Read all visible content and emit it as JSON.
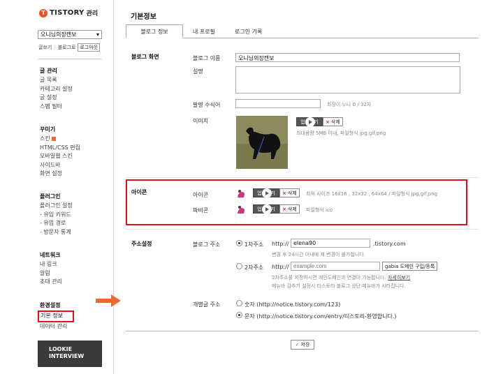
{
  "sidebar": {
    "logo_mark": "T",
    "logo_text": "TISTORY",
    "logo_sub": "관리",
    "blog_select": "오니님의장캔보",
    "quick_links": [
      "글쓰기",
      "블로그로"
    ],
    "logout": "로그아웃",
    "groups": [
      {
        "title": "글 관리",
        "items": [
          "글 목록",
          "카테고리 설정",
          "글 설정",
          "스팸 필터"
        ]
      },
      {
        "title": "꾸미기",
        "items": [
          "스킨",
          "HTML/CSS 편집",
          "모바일웹 스킨",
          "사이드바",
          "화면 설정"
        ]
      },
      {
        "title": "플러그인",
        "items": [
          "플러그인 설정",
          "- 유입 키워드",
          "- 유입 경로",
          "- 방문자 통계"
        ]
      },
      {
        "title": "네트워크",
        "items": [
          "내 링크",
          "알림",
          "초대 관리"
        ]
      },
      {
        "title": "환경설정",
        "items": [
          "기본 정보",
          "데이터 관리"
        ]
      }
    ],
    "banner_line1": "LOOKIE",
    "banner_line2": "INTERVIEW"
  },
  "main": {
    "title": "기본정보",
    "tabs": [
      "블로그 정보",
      "내 프로필",
      "로그인 기록"
    ],
    "blog_section": {
      "label": "블로그 화면",
      "name_label": "블로그 이름",
      "name_value": "오니님의장캔보",
      "desc_label": "설명",
      "modifier_label": "팔명 수식어",
      "modifier_hint_prefix": "최장이 누나",
      "modifier_count": "0",
      "modifier_max": "/ 32자",
      "image_label": "이미지",
      "image_hint": "최대용량 5MB 이내, 파일형식 jpg,gif,png"
    },
    "icon_section": {
      "label": "아이콘",
      "icon_label": "아이콘",
      "icon_hint": "최적 사이즈 16x16 , 32x32 , 64x64 / 파일형식 jpg,gif,png",
      "favicon_label": "파비콘",
      "favicon_hint": "파일형식 ico"
    },
    "buttons": {
      "change": "업로드기",
      "delete": "삭제",
      "save": "저장",
      "gabia": "gabia 도메인 구입/등록"
    },
    "address_section": {
      "label": "주소설정",
      "blog_address_label": "블로그 주소",
      "primary_label": "1차주소",
      "http_prefix": "http://",
      "primary_value": "elena90",
      "primary_suffix": ".tistory.com",
      "primary_hint": "변경 후 24시간 이내에 재 변경이 불가합니다.",
      "secondary_label": "2차주소",
      "secondary_placeholder": "example.com",
      "secondary_hint1": "2차주소를 지정하시면 개인도메인과 연결이 가능합니다.",
      "secondary_hint_link": "자세히보기",
      "secondary_hint2": "메뉴바 감추기 설정시 티스토리 블로그 상단 메뉴바가 사라집니다.",
      "permalink_label": "개별글 주소",
      "permalink_number": "숫자 (http://notice.tistory.com/123)",
      "permalink_text": "문자 (http://notice.tistory.com/entry/티스토리-환영합니다.)"
    }
  },
  "colors": {
    "accent": "#eb531f",
    "highlight": "#e0101a",
    "banner_bg": "#3b3b3b"
  }
}
